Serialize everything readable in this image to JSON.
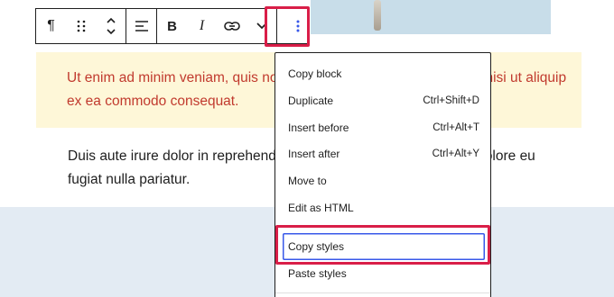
{
  "toolbar": {
    "paragraph_icon": "¶",
    "drag_icon": "⠿",
    "bold_label": "B",
    "italic_label": "I",
    "options_icon": "⋮"
  },
  "content": {
    "quote_text": "Ut enim ad minim veniam, quis nostrud exercitation ullamco laboris nisi ut aliquip ex ea commodo consequat.",
    "paragraph_text": "Duis aute irure dolor in reprehenderit in voluptate velit esse cillum dolore eu fugiat nulla pariatur."
  },
  "menu": {
    "items": [
      {
        "label": "Copy block",
        "shortcut": ""
      },
      {
        "label": "Duplicate",
        "shortcut": "Ctrl+Shift+D"
      },
      {
        "label": "Insert before",
        "shortcut": "Ctrl+Alt+T"
      },
      {
        "label": "Insert after",
        "shortcut": "Ctrl+Alt+Y"
      },
      {
        "label": "Move to",
        "shortcut": ""
      },
      {
        "label": "Edit as HTML",
        "shortcut": ""
      },
      {
        "label": "Copy styles",
        "shortcut": ""
      },
      {
        "label": "Paste styles",
        "shortcut": ""
      }
    ]
  },
  "colors": {
    "highlight": "#d91e48",
    "quote_text": "#c13a2e",
    "quote_bg": "#fef7d8",
    "focus": "#3858e9"
  }
}
